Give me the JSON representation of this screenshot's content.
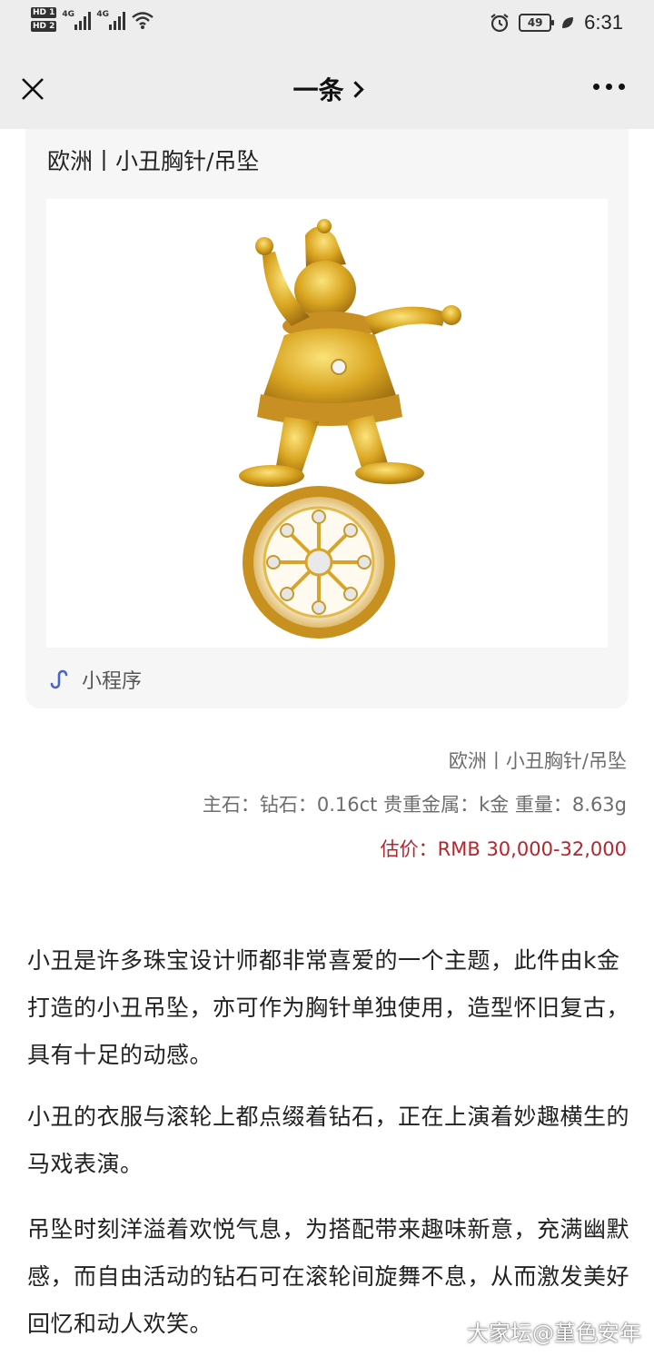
{
  "status_bar": {
    "sim1": "HD 1",
    "sim2": "HD 2",
    "network1": "4G",
    "network2": "4G",
    "battery": "49",
    "time": "6:31"
  },
  "nav": {
    "title": "一条",
    "close_icon": "close-icon",
    "more_icon": "more-icon"
  },
  "card": {
    "title": "欧洲丨小丑胸针/吊坠",
    "mini_program_label": "小程序",
    "image": "clown-brooch-pendant"
  },
  "caption": {
    "line1": "欧洲丨小丑胸针/吊坠",
    "line2": "主石：钻石：0.16ct 贵重金属：k金 重量：8.63g",
    "line3": "估价：RMB 30,000-32,000",
    "price_color": "#b5252e"
  },
  "body": {
    "paragraph1": "小丑是许多珠宝设计师都非常喜爱的一个主题，此件由k金打造的小丑吊坠，亦可作为胸针单独使用，造型怀旧复古，具有十足的动感。",
    "paragraph2": "小丑的衣服与滚轮上都点缀着钻石，正在上演着妙趣横生的马戏表演。",
    "paragraph3": "吊坠时刻洋溢着欢悦气息，为搭配带来趣味新意，充满幽默感，而自由活动的钻石可在滚轮间旋舞不息，从而激发美好回忆和动人欢笑。"
  },
  "watermark": "大家坛@堇色安年"
}
